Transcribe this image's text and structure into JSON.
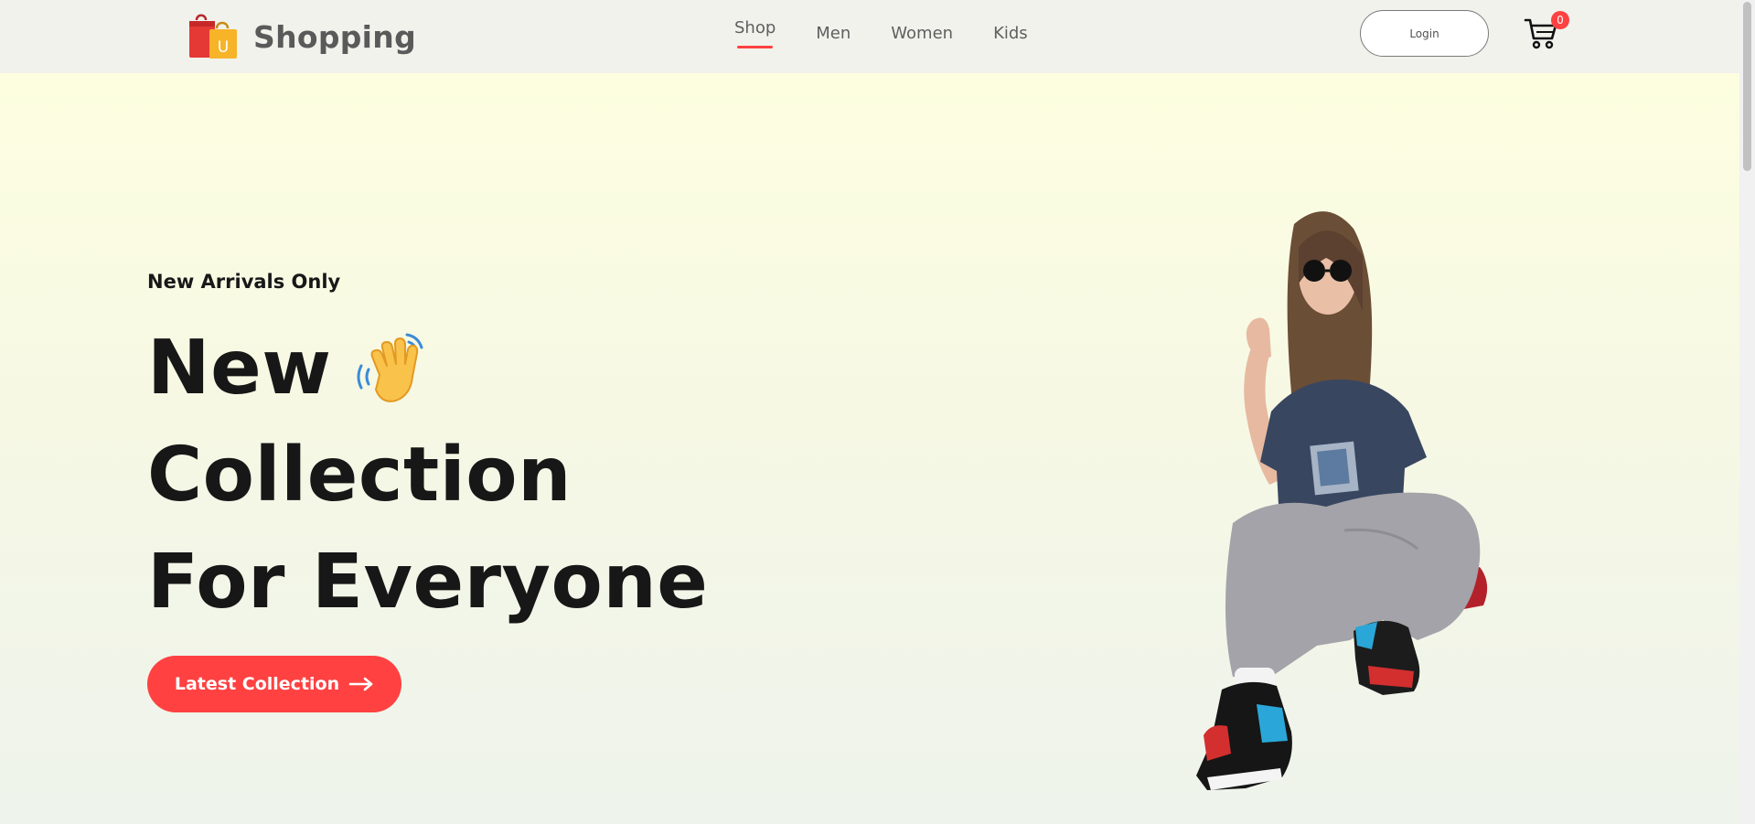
{
  "brand": {
    "name": "Shopping",
    "logo_letter": "U",
    "accent": "#ff4141"
  },
  "nav": {
    "items": [
      {
        "label": "Shop",
        "active": true
      },
      {
        "label": "Men",
        "active": false
      },
      {
        "label": "Women",
        "active": false
      },
      {
        "label": "Kids",
        "active": false
      }
    ]
  },
  "header": {
    "login_label": "Login",
    "cart_count": "0",
    "cart_icon": "cart-icon"
  },
  "hero": {
    "kicker": "New Arrivals Only",
    "headline": [
      "New",
      "Collection",
      "For Everyone"
    ],
    "headline_icon": "waving-hand-icon",
    "cta_label": "Latest Collection",
    "cta_icon": "arrow-right-icon",
    "image": "fashion-model-image"
  }
}
